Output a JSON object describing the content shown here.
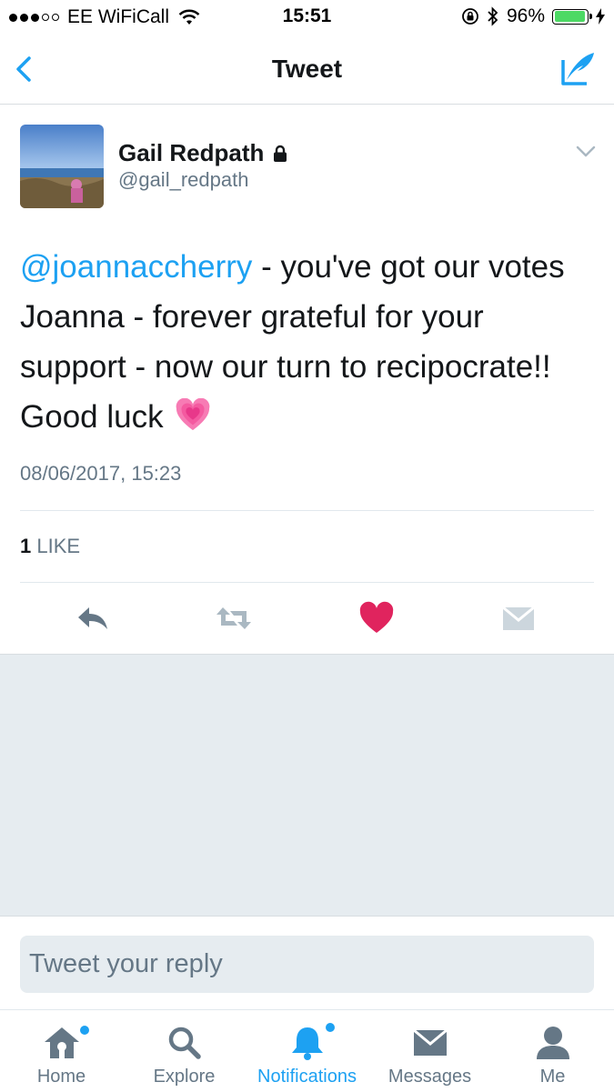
{
  "status_bar": {
    "carrier": "EE WiFiCall",
    "time": "15:51",
    "battery_percent": "96%",
    "battery_level": 0.96,
    "icons": [
      "signal-dots",
      "wifi-icon",
      "rotation-lock-icon",
      "bluetooth-icon",
      "battery-icon",
      "charging-icon"
    ]
  },
  "nav": {
    "title": "Tweet",
    "back_icon": "chevron-left-icon",
    "compose_icon": "compose-tweet-icon"
  },
  "tweet": {
    "author_name": "Gail Redpath",
    "author_handle": "@gail_redpath",
    "protected_icon": "lock-icon",
    "mention": "@joannaccherry",
    "text": " - you've got our votes Joanna - forever grateful for your support - now our turn to recipocrate!! Good luck",
    "emoji": "growing-heart-emoji",
    "timestamp": "08/06/2017, 15:23",
    "like_count": "1",
    "like_label": "LIKE"
  },
  "actions": [
    "reply-icon",
    "retweet-icon",
    "like-icon",
    "direct-message-icon"
  ],
  "reply": {
    "placeholder": "Tweet your reply"
  },
  "tabs": [
    {
      "label": "Home",
      "icon": "home-icon",
      "badge": true
    },
    {
      "label": "Explore",
      "icon": "search-icon"
    },
    {
      "label": "Notifications",
      "icon": "bell-icon",
      "active": true,
      "badge": true
    },
    {
      "label": "Messages",
      "icon": "envelope-icon"
    },
    {
      "label": "Me",
      "icon": "person-icon"
    }
  ],
  "colors": {
    "accent": "#1da1f2",
    "like": "#e0245e",
    "muted": "#657786",
    "background_gray": "#e6ecf0"
  }
}
